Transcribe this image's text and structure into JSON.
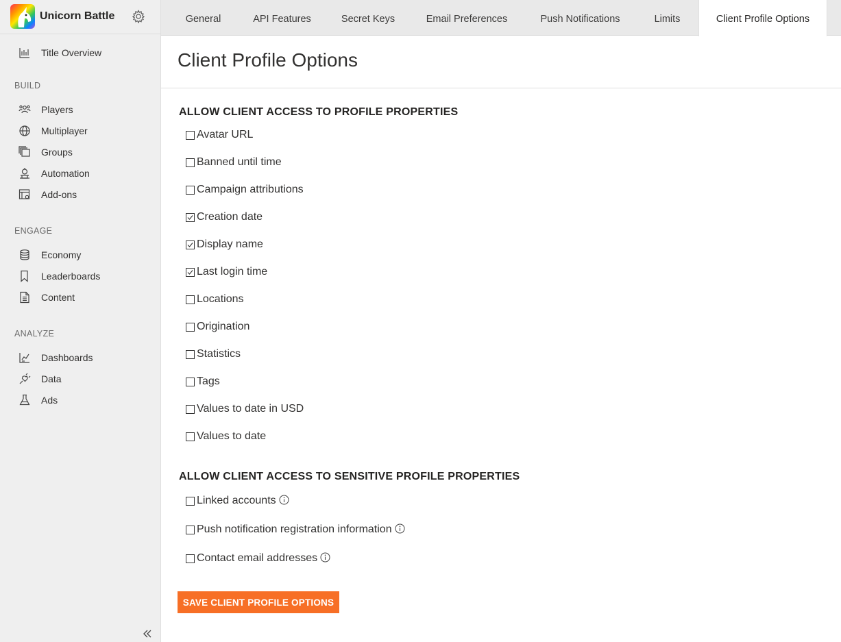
{
  "app": {
    "title": "Unicorn Battle",
    "logo": "unicorn-logo",
    "settings_icon": "gear-icon"
  },
  "sidebar": {
    "top_item": {
      "label": "Title Overview",
      "icon": "bar-chart-icon"
    },
    "sections": [
      {
        "label": "BUILD",
        "items": [
          {
            "label": "Players",
            "icon": "people-icon"
          },
          {
            "label": "Multiplayer",
            "icon": "globe-icon"
          },
          {
            "label": "Groups",
            "icon": "stack-icon"
          },
          {
            "label": "Automation",
            "icon": "robot-icon"
          },
          {
            "label": "Add-ons",
            "icon": "addon-icon"
          }
        ]
      },
      {
        "label": "ENGAGE",
        "items": [
          {
            "label": "Economy",
            "icon": "coins-icon"
          },
          {
            "label": "Leaderboards",
            "icon": "bookmark-icon"
          },
          {
            "label": "Content",
            "icon": "document-icon"
          }
        ]
      },
      {
        "label": "ANALYZE",
        "items": [
          {
            "label": "Dashboards",
            "icon": "dashboard-icon"
          },
          {
            "label": "Data",
            "icon": "plug-icon"
          },
          {
            "label": "Ads",
            "icon": "flask-icon"
          }
        ]
      }
    ],
    "collapse_icon": "double-chevron-left-icon"
  },
  "tabs": [
    {
      "label": "General",
      "active": false
    },
    {
      "label": "API Features",
      "active": false
    },
    {
      "label": "Secret Keys",
      "active": false
    },
    {
      "label": "Email Preferences",
      "active": false
    },
    {
      "label": "Push Notifications",
      "active": false
    },
    {
      "label": "Limits",
      "active": false
    },
    {
      "label": "Client Profile Options",
      "active": true
    }
  ],
  "page": {
    "title": "Client Profile Options",
    "groups": [
      {
        "title": "ALLOW CLIENT ACCESS TO PROFILE PROPERTIES",
        "options": [
          {
            "label": "Avatar URL",
            "checked": false
          },
          {
            "label": "Banned until time",
            "checked": false
          },
          {
            "label": "Campaign attributions",
            "checked": false
          },
          {
            "label": "Creation date",
            "checked": true
          },
          {
            "label": "Display name",
            "checked": true
          },
          {
            "label": "Last login time",
            "checked": true
          },
          {
            "label": "Locations",
            "checked": false
          },
          {
            "label": "Origination",
            "checked": false
          },
          {
            "label": "Statistics",
            "checked": false
          },
          {
            "label": "Tags",
            "checked": false
          },
          {
            "label": "Values to date in USD",
            "checked": false
          },
          {
            "label": "Values to date",
            "checked": false
          }
        ]
      },
      {
        "title": "ALLOW CLIENT ACCESS TO SENSITIVE PROFILE PROPERTIES",
        "options": [
          {
            "label": "Linked accounts",
            "checked": false,
            "info_icon": "info-icon"
          },
          {
            "label": "Push notification registration information",
            "checked": false,
            "info_icon": "info-icon"
          },
          {
            "label": "Contact email addresses",
            "checked": false,
            "info_icon": "info-icon"
          }
        ]
      }
    ],
    "save_label": "SAVE CLIENT PROFILE OPTIONS"
  },
  "colors": {
    "accent": "#f76f26",
    "sidebar_bg": "#efefef",
    "tabbar_bg": "#e9e9e9"
  }
}
